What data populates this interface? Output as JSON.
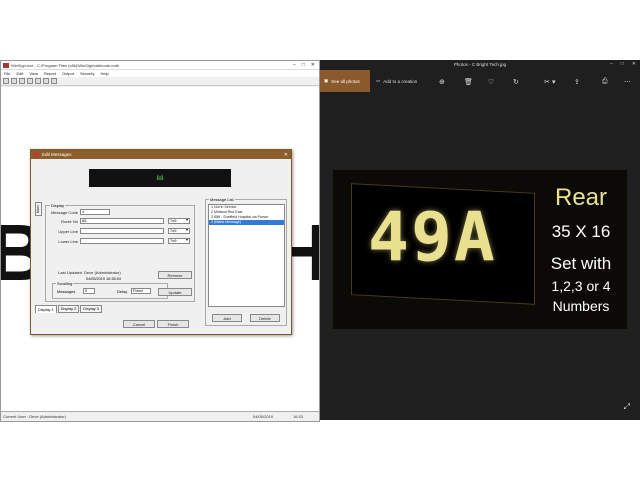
{
  "left_window": {
    "title": "WinSign.exe - C:\\Program Files (x86)\\WinSign\\dat\\route.mdb",
    "menu": [
      "File",
      "Edit",
      "View",
      "Report",
      "Output",
      "Security",
      "Help"
    ],
    "background_letters": [
      "B",
      "H"
    ],
    "status": {
      "user": "Current User : Deve (Administrator)",
      "date": "04/05/2019",
      "time": "16:33"
    }
  },
  "dialog": {
    "title": "Edit Messages",
    "led_text": "88",
    "main_tab": "Main",
    "display_group": "Display",
    "fields": {
      "message_code_label": "Message Code",
      "message_code_value": "4",
      "route_no_label": "Route No",
      "route_no_value": "88",
      "upper_line_label": "Upper Line",
      "upper_line_value": "",
      "lower_line_label": "Lower Line",
      "lower_line_value": "",
      "font_select": "7x9"
    },
    "last_updated_label": "Last Updated",
    "last_updated_user": "Deve (Administrator)",
    "last_updated_time": "04/05/2019 16:35:54",
    "scrolling_group": "Scrolling",
    "messages_label": "Messages",
    "messages_value": "0",
    "delay_label": "Delay",
    "delay_value": "Fixed",
    "remove_button": "Remove",
    "update_button": "Update",
    "bottom_tabs": [
      "Display 1",
      "Display 2",
      "Display 3"
    ],
    "cancel_button": "Cancel",
    "finish_button": "Finish",
    "message_list_group": "Message List",
    "message_list": [
      "1    Not in Service",
      "2    Midland Red East",
      "3    888 - Sheffield Hospital via Purser",
      "4    (Blank Message)"
    ],
    "selected_index": 3,
    "add_button": "Add",
    "delete_button": "Delete"
  },
  "right_window": {
    "title": "Photos - C Bright Tech.jpg",
    "see_all_label": "See all photos",
    "add_creation_label": "Add to a creation",
    "toolbar_icons": [
      "zoom-in-icon",
      "delete-icon",
      "heart-icon",
      "rotate-icon",
      "crop-icon",
      "edit-icon",
      "share-icon",
      "print-icon",
      "more-icon"
    ],
    "photo": {
      "sign_text": "49A",
      "heading": "Rear",
      "size": "35 X 16",
      "line1": "Set with",
      "line2": "1,2,3 or 4",
      "line3": "Numbers"
    }
  },
  "colors": {
    "dialog_title": "#8b5e2b",
    "photo_accent": "#e9e190",
    "see_all_bg": "#8a5a2c",
    "selection": "#3379d6"
  }
}
